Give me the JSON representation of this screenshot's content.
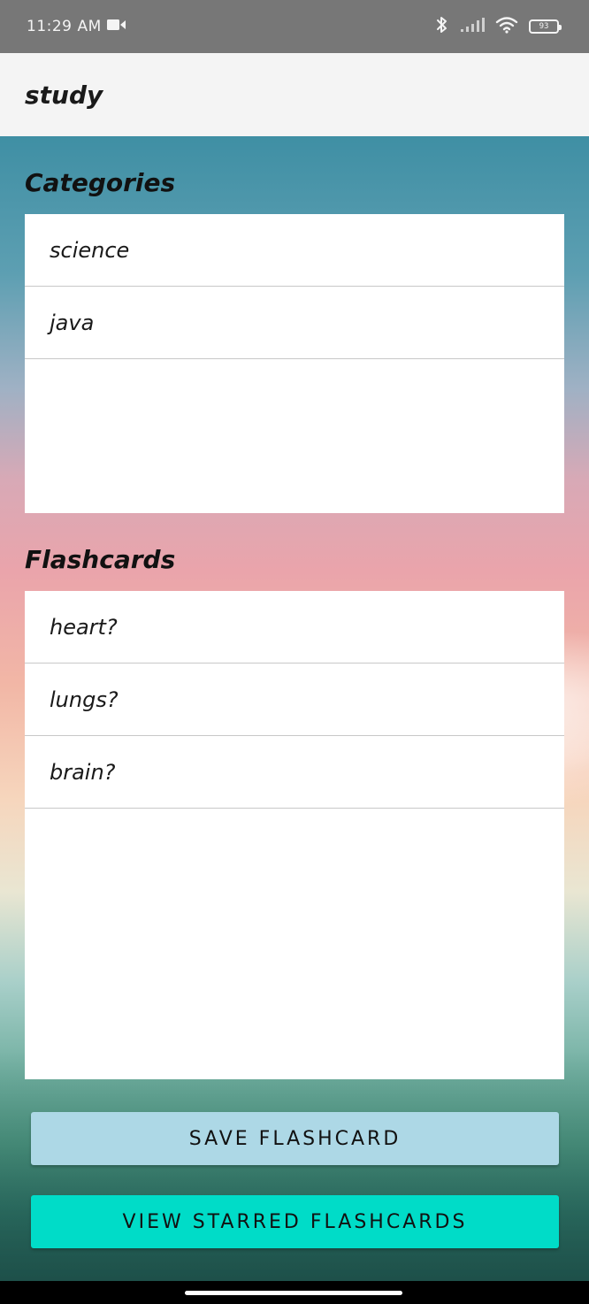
{
  "status_bar": {
    "time": "11:29",
    "ampm": "AM",
    "battery": "93"
  },
  "app_bar": {
    "title": "study"
  },
  "categories": {
    "title": "Categories",
    "items": [
      {
        "label": "science"
      },
      {
        "label": "java"
      }
    ]
  },
  "flashcards": {
    "title": "Flashcards",
    "items": [
      {
        "label": "heart?"
      },
      {
        "label": "lungs?"
      },
      {
        "label": "brain?"
      }
    ]
  },
  "buttons": {
    "save_label": "SAVE FLASHCARD",
    "starred_label": "VIEW STARRED FLASHCARDS"
  },
  "colors": {
    "save_button": "#add8e6",
    "starred_button": "#00dcc8",
    "app_bar": "#f4f4f4",
    "status_bar": "#777777"
  }
}
